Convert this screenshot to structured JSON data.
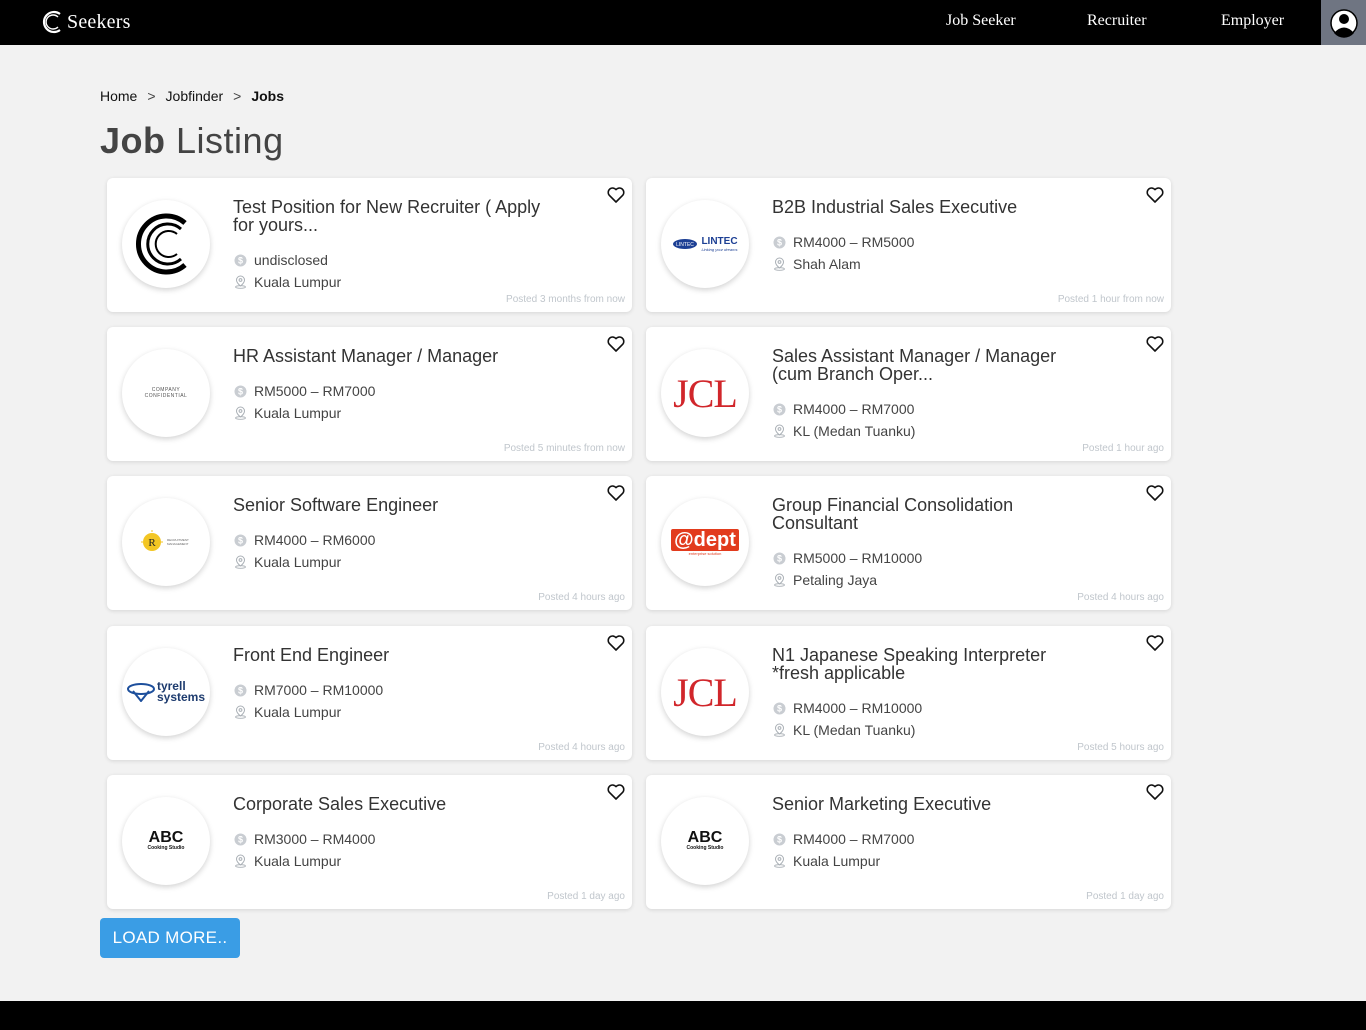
{
  "header": {
    "brand": "Seekers",
    "nav": [
      {
        "label": "Job Seeker"
      },
      {
        "label": "Recruiter"
      },
      {
        "label": "Employer"
      }
    ]
  },
  "breadcrumb": {
    "home": "Home",
    "jobfinder": "Jobfinder",
    "current": "Jobs"
  },
  "title": {
    "bold": "Job",
    "rest": "Listing"
  },
  "colors": {
    "accent": "#3a9de5",
    "topbar": "#000000",
    "avatar_bg": "#6f7582"
  },
  "jobs": [
    {
      "title": "Test Position for New Recruiter ( Apply for yours...",
      "salary": "undisclosed",
      "location": "Kuala Lumpur",
      "posted": "Posted 3 months from now",
      "logo": "seekers-logo"
    },
    {
      "title": "B2B Industrial Sales Executive",
      "salary": "RM4000 – RM5000",
      "location": "Shah Alam",
      "posted": "Posted 1 hour from now",
      "logo": "lintec-logo",
      "logo_text": "LINTEC",
      "logo_sub": "Linking your dreams"
    },
    {
      "title": "HR Assistant Manager / Manager",
      "salary": "RM5000 – RM7000",
      "location": "Kuala Lumpur",
      "posted": "Posted 5 minutes from now",
      "logo": "company-confidential-logo",
      "logo_text": "COMPANY CONFIDENTIAL"
    },
    {
      "title": "Sales Assistant Manager / Manager (cum Branch Oper...",
      "salary": "RM4000 – RM7000",
      "location": "KL (Medan Tuanku)",
      "posted": "Posted 1 hour ago",
      "logo": "jcl-logo",
      "logo_text": "JCL"
    },
    {
      "title": "Senior Software Engineer",
      "salary": "RM4000 – RM6000",
      "location": "Kuala Lumpur",
      "posted": "Posted 4 hours ago",
      "logo": "rv-recruitment-logo",
      "logo_text": "RECRUITMENT MANAGEMENT"
    },
    {
      "title": "Group Financial Consolidation Consultant",
      "salary": "RM5000 – RM10000",
      "location": "Petaling Jaya",
      "posted": "Posted 4 hours ago",
      "logo": "adept-logo",
      "logo_text": "@dept",
      "logo_sub": "enterprise solution"
    },
    {
      "title": "Front End Engineer",
      "salary": "RM7000 – RM10000",
      "location": "Kuala Lumpur",
      "posted": "Posted 4 hours ago",
      "logo": "tyrell-logo",
      "logo_text": "tyrell",
      "logo_sub": "systems"
    },
    {
      "title": "N1 Japanese Speaking Interpreter *fresh applicable",
      "salary": "RM4000 – RM10000",
      "location": "KL (Medan Tuanku)",
      "posted": "Posted 5 hours ago",
      "logo": "jcl-logo",
      "logo_text": "JCL"
    },
    {
      "title": "Corporate Sales Executive",
      "salary": "RM3000 – RM4000",
      "location": "Kuala Lumpur",
      "posted": "Posted 1 day ago",
      "logo": "abc-logo",
      "logo_text": "ABC",
      "logo_sub": "Cooking Studio"
    },
    {
      "title": "Senior Marketing Executive",
      "salary": "RM4000 – RM7000",
      "location": "Kuala Lumpur",
      "posted": "Posted 1 day ago",
      "logo": "abc-logo",
      "logo_text": "ABC",
      "logo_sub": "Cooking Studio"
    }
  ],
  "load_more": "LOAD MORE.."
}
